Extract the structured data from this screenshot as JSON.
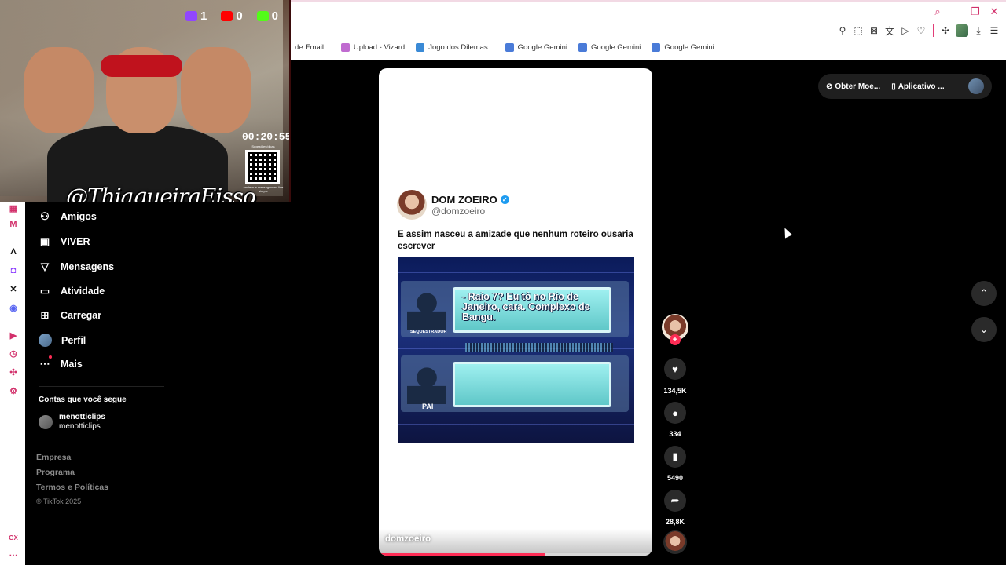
{
  "stream_overlay": {
    "twitch_count": "1",
    "youtube_count": "0",
    "kick_count": "0",
    "timer": "00:20:55",
    "handle": "@ThiagueiraEisso",
    "qr_top_text": "Sugestões/dicas",
    "qr_bottom_text": "envie sua mensagem na live via pix"
  },
  "bookmarks": [
    {
      "label": "de Email...",
      "icon": "mail-icon",
      "color": "#777777"
    },
    {
      "label": "Upload - Vizard",
      "icon": "vizard-icon",
      "color": "#c06bd0"
    },
    {
      "label": "Jogo dos Dilemas...",
      "icon": "game-icon",
      "color": "#3a8ad6"
    },
    {
      "label": "Google Gemini",
      "icon": "gemini-icon",
      "color": "#4a7bd8"
    },
    {
      "label": "Google Gemini",
      "icon": "gemini-icon",
      "color": "#4a7bd8"
    },
    {
      "label": "Google Gemini",
      "icon": "gemini-icon",
      "color": "#4a7bd8"
    }
  ],
  "nav": {
    "items": [
      {
        "label": "Amigos",
        "icon": "friends-icon"
      },
      {
        "label": "VIVER",
        "icon": "live-icon"
      },
      {
        "label": "Mensagens",
        "icon": "messages-icon"
      },
      {
        "label": "Atividade",
        "icon": "activity-icon"
      },
      {
        "label": "Carregar",
        "icon": "upload-icon"
      },
      {
        "label": "Perfil",
        "icon": "avatar"
      },
      {
        "label": "Mais",
        "icon": "more-icon"
      }
    ],
    "following_title": "Contas que você segue",
    "following": [
      {
        "name": "menotticlips",
        "username": "menotticlips"
      }
    ],
    "footer": [
      "Empresa",
      "Programa",
      "Termos e Políticas"
    ],
    "copyright": "© TikTok 2025"
  },
  "video": {
    "tweet_name": "DOM ZOEIRO",
    "tweet_handle": "@domzoeiro",
    "tweet_text": "E assim nasceu a amizade que nenhum roteiro ousaria escrever",
    "media_quote": "- Raio 7? Eu tô no Rio de Janeiro, cara. Complexo de Bangu.",
    "media_label_1": "SEQUESTRADOR",
    "media_label_2": "PAI",
    "author": "domzoeiro",
    "progress_fraction": 0.61
  },
  "actions": {
    "likes": "134,5K",
    "comments": "334",
    "saves": "5490",
    "shares": "28,8K"
  },
  "right_header": {
    "coins_label": "Obter Moe...",
    "app_label": "Aplicativo ..."
  },
  "colors": {
    "accent": "#fe2c55",
    "browser_accent": "#d2306b"
  }
}
